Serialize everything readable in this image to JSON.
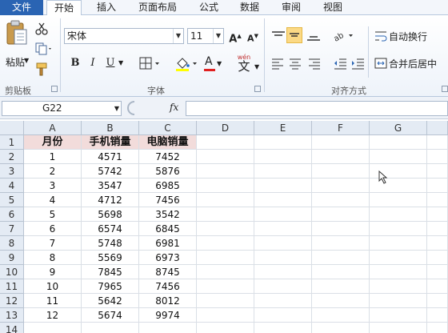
{
  "tabs": [
    "文件",
    "开始",
    "插入",
    "页面布局",
    "公式",
    "数据",
    "审阅",
    "视图"
  ],
  "clipboard": {
    "paste": "粘贴",
    "group": "剪贴板"
  },
  "font": {
    "name": "宋体",
    "size": "11",
    "bold": "B",
    "italic": "I",
    "underline": "U",
    "grow": "A",
    "shrink": "A",
    "color_letter": "A",
    "wen": "wén",
    "wen_char": "文",
    "group": "字体"
  },
  "align": {
    "wrap": "自动换行",
    "merge": "合并后居中",
    "group": "对齐方式"
  },
  "formula_bar": {
    "cell_ref": "G22",
    "fx": "fx"
  },
  "columns": [
    "A",
    "B",
    "C",
    "D",
    "E",
    "F",
    "G"
  ],
  "rows": [
    "1",
    "2",
    "3",
    "4",
    "5",
    "6",
    "7",
    "8",
    "9",
    "10",
    "11",
    "12",
    "13",
    "14"
  ],
  "table": {
    "headers": [
      "月份",
      "手机销量",
      "电脑销量"
    ],
    "data": [
      [
        "1",
        "4571",
        "7452"
      ],
      [
        "2",
        "5742",
        "5876"
      ],
      [
        "3",
        "3547",
        "6985"
      ],
      [
        "4",
        "4712",
        "7456"
      ],
      [
        "5",
        "5698",
        "3542"
      ],
      [
        "6",
        "6574",
        "6845"
      ],
      [
        "7",
        "5748",
        "6981"
      ],
      [
        "8",
        "5569",
        "6973"
      ],
      [
        "9",
        "7845",
        "8745"
      ],
      [
        "10",
        "7965",
        "7456"
      ],
      [
        "11",
        "5642",
        "8012"
      ],
      [
        "12",
        "5674",
        "9974"
      ]
    ]
  },
  "colors": {
    "file_tab": "#2a64b3",
    "header_fill": "#f2dcdb",
    "font_color_bar": "#e02020",
    "fill_color_bar": "#ffff00"
  }
}
